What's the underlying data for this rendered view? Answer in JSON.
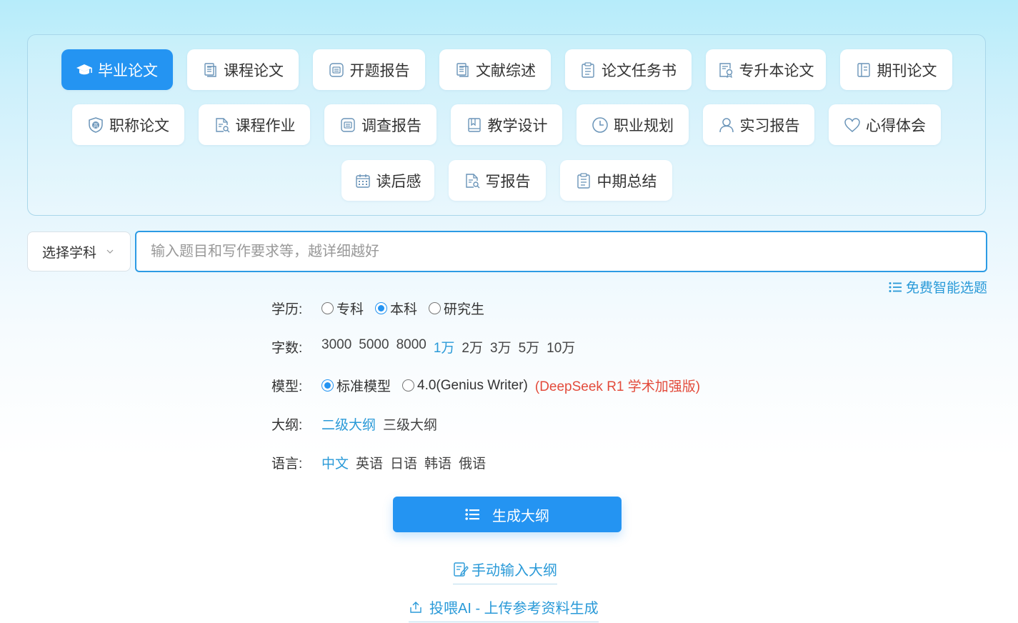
{
  "categories_row1": [
    {
      "label": "毕业论文",
      "icon": "graduation-cap-icon",
      "active": true
    },
    {
      "label": "课程论文",
      "icon": "document-icon"
    },
    {
      "label": "开题报告",
      "icon": "report-icon"
    },
    {
      "label": "文献综述",
      "icon": "document-icon"
    },
    {
      "label": "论文任务书",
      "icon": "clipboard-icon"
    },
    {
      "label": "专升本论文",
      "icon": "certificate-icon"
    },
    {
      "label": "期刊论文",
      "icon": "journal-icon"
    }
  ],
  "categories_row2": [
    {
      "label": "职称论文",
      "icon": "shield-badge-icon"
    },
    {
      "label": "课程作业",
      "icon": "file-search-icon"
    },
    {
      "label": "调查报告",
      "icon": "report-icon"
    },
    {
      "label": "教学设计",
      "icon": "book-icon"
    },
    {
      "label": "职业规划",
      "icon": "clock-icon"
    },
    {
      "label": "实习报告",
      "icon": "user-icon"
    },
    {
      "label": "心得体会",
      "icon": "heart-icon"
    }
  ],
  "categories_row3": [
    {
      "label": "读后感",
      "icon": "calendar-icon"
    },
    {
      "label": "写报告",
      "icon": "file-search-icon"
    },
    {
      "label": "中期总结",
      "icon": "clipboard-icon"
    }
  ],
  "subject_select": {
    "label": "选择学科"
  },
  "topic_input": {
    "placeholder": "输入题目和写作要求等，越详细越好",
    "value": ""
  },
  "free_topic_link": "免费智能选题",
  "education": {
    "label": "学历:",
    "options": [
      "专科",
      "本科",
      "研究生"
    ],
    "selected": "本科"
  },
  "word_count": {
    "label": "字数:",
    "options": [
      "3000",
      "5000",
      "8000",
      "1万",
      "2万",
      "3万",
      "5万",
      "10万"
    ],
    "selected": "1万"
  },
  "model": {
    "label": "模型:",
    "options": [
      "标准模型",
      "4.0(Genius Writer)"
    ],
    "selected": "标准模型",
    "note": "(DeepSeek R1 学术加强版)"
  },
  "outline_level": {
    "label": "大纲:",
    "options": [
      "二级大纲",
      "三级大纲"
    ],
    "selected": "二级大纲"
  },
  "language": {
    "label": "语言:",
    "options": [
      "中文",
      "英语",
      "日语",
      "韩语",
      "俄语"
    ],
    "selected": "中文"
  },
  "generate_button": "生成大纲",
  "manual_outline_link": "手动输入大纲",
  "upload_link": "投喂AI - 上传参考资料生成",
  "colors": {
    "accent": "#2494f2",
    "link": "#2a9ad8",
    "note": "#e34b3b"
  }
}
